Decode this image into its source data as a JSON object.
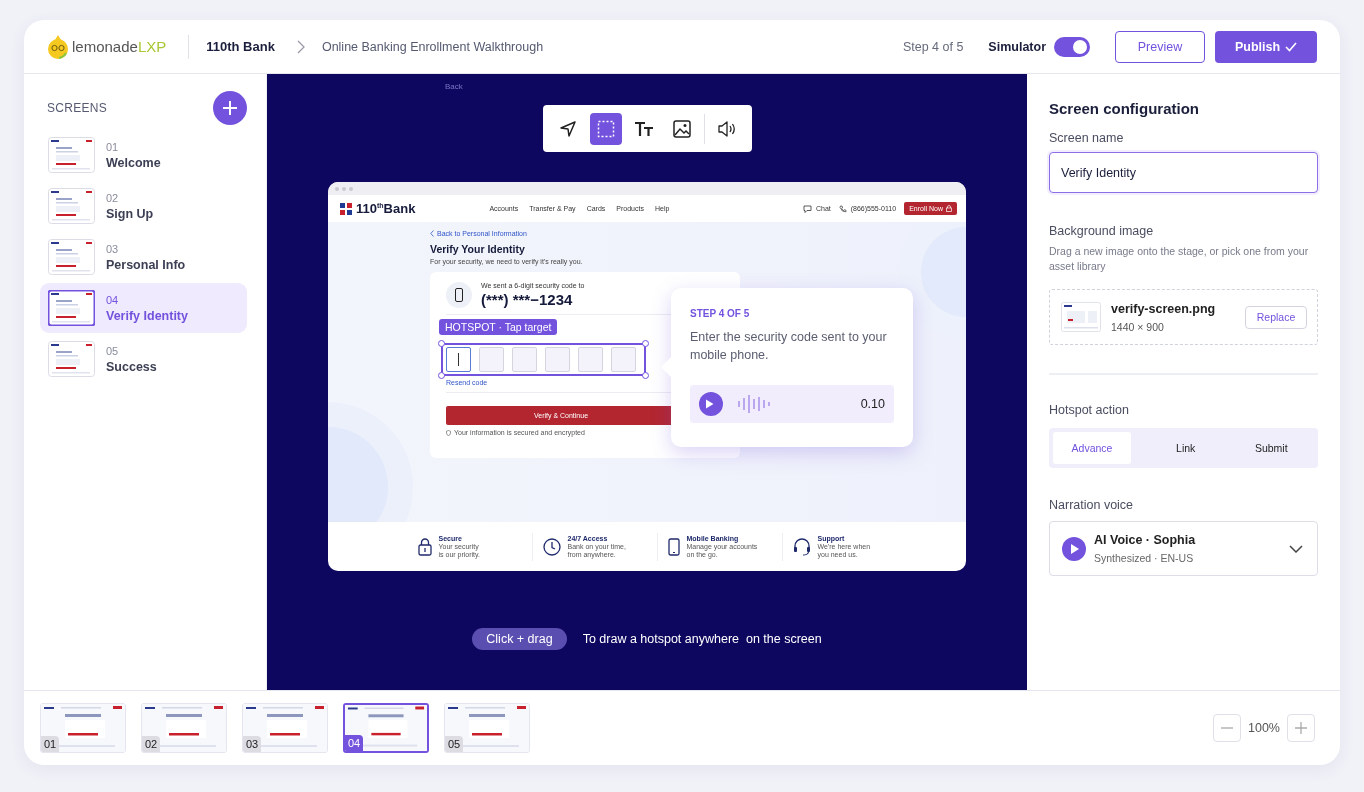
{
  "header": {
    "logo": "lemonade",
    "logo_accent": "LXP",
    "project": "110th Bank",
    "walkthrough": "Online Banking Enrollment Walkthrough",
    "step": "Step 4 of 5",
    "simulator": {
      "label": "Simulator",
      "on": true
    },
    "preview": "Preview",
    "publish": "Publish"
  },
  "sidebar": {
    "title": "SCREENS",
    "items": [
      {
        "number": "01",
        "name": "Welcome",
        "selected": false
      },
      {
        "number": "02",
        "name": "Sign Up",
        "selected": false
      },
      {
        "number": "03",
        "name": "Personal Info",
        "selected": false
      },
      {
        "number": "04",
        "name": "Verify Identity",
        "selected": true
      },
      {
        "number": "05",
        "name": "Success",
        "selected": false
      }
    ]
  },
  "stage": {
    "back": "Back",
    "tools": [
      {
        "kind": "pointer",
        "selected": false
      },
      {
        "kind": "select",
        "selected": true
      },
      {
        "kind": "text",
        "selected": false
      },
      {
        "kind": "image",
        "selected": false
      },
      {
        "kind": "audio",
        "selected": false
      }
    ],
    "mockup": {
      "brand": "110$^{th}$Bank",
      "nav": [
        "Accounts",
        "Transfer & Pay",
        "Cards",
        "Products",
        "Help"
      ],
      "chat": "Chat",
      "phone": "(866)555-0110",
      "enroll": "Enroll Now",
      "back_link": "Back to Personal Information",
      "title": "Verify Your Identity",
      "subtitle": "For your security, we need to verify it's really you.",
      "sent_label": "We sent a 6-digit security code to",
      "masked_phone": "(***) ***−1234",
      "hotspot_label": "HOTSPOT · Tap target",
      "code_boxes": [
        {
          "focused": true
        },
        {
          "focused": false
        },
        {
          "focused": false
        },
        {
          "focused": false
        },
        {
          "focused": false
        },
        {
          "focused": false
        }
      ],
      "resend": "Resend code",
      "verify": "Verify & Continue",
      "secure_note": "Your information is secured and encrypted",
      "features": [
        {
          "kind": "lock",
          "title": "Secure",
          "lines": [
            "Your security",
            "is our priority."
          ]
        },
        {
          "kind": "clock",
          "title": "24/7 Access",
          "lines": [
            "Bank on your time,",
            "from anywhere."
          ]
        },
        {
          "kind": "phone",
          "title": "Mobile Banking",
          "lines": [
            "Manage your accounts",
            "on the go."
          ]
        },
        {
          "kind": "headset",
          "title": "Support",
          "lines": [
            "We're here when",
            "you need us."
          ]
        }
      ]
    },
    "callout": {
      "step": "STEP 4 OF 5",
      "text": "Enter the security code sent to your mobile phone.",
      "time": "0.10"
    },
    "hint": {
      "chip": "Click + drag",
      "text": "To draw a hotspot anywhere  on the screen"
    }
  },
  "panel": {
    "title": "Screen configuration",
    "name_label": "Screen name",
    "name_value": "Verify Identity",
    "bg_label": "Background image",
    "bg_help": "Drag a new image onto the stage, or pick one from your asset library",
    "file_name": "verify-screen.png",
    "file_size": "1440 × 900",
    "replace": "Replace",
    "action_label": "Hotspot action",
    "actions": [
      {
        "label": "Advance",
        "selected": true
      },
      {
        "label": "Link",
        "selected": false
      },
      {
        "label": "Submit",
        "selected": false
      }
    ],
    "voice_label": "Narration voice",
    "voice_name": "AI Voice · Sophia",
    "voice_sub": "Synthesized · EN-US"
  },
  "filmstrip": {
    "thumbs": [
      {
        "number": "01",
        "selected": false
      },
      {
        "number": "02",
        "selected": false
      },
      {
        "number": "03",
        "selected": false
      },
      {
        "number": "04",
        "selected": true
      },
      {
        "number": "05",
        "selected": false
      }
    ],
    "zoom": "100%"
  }
}
